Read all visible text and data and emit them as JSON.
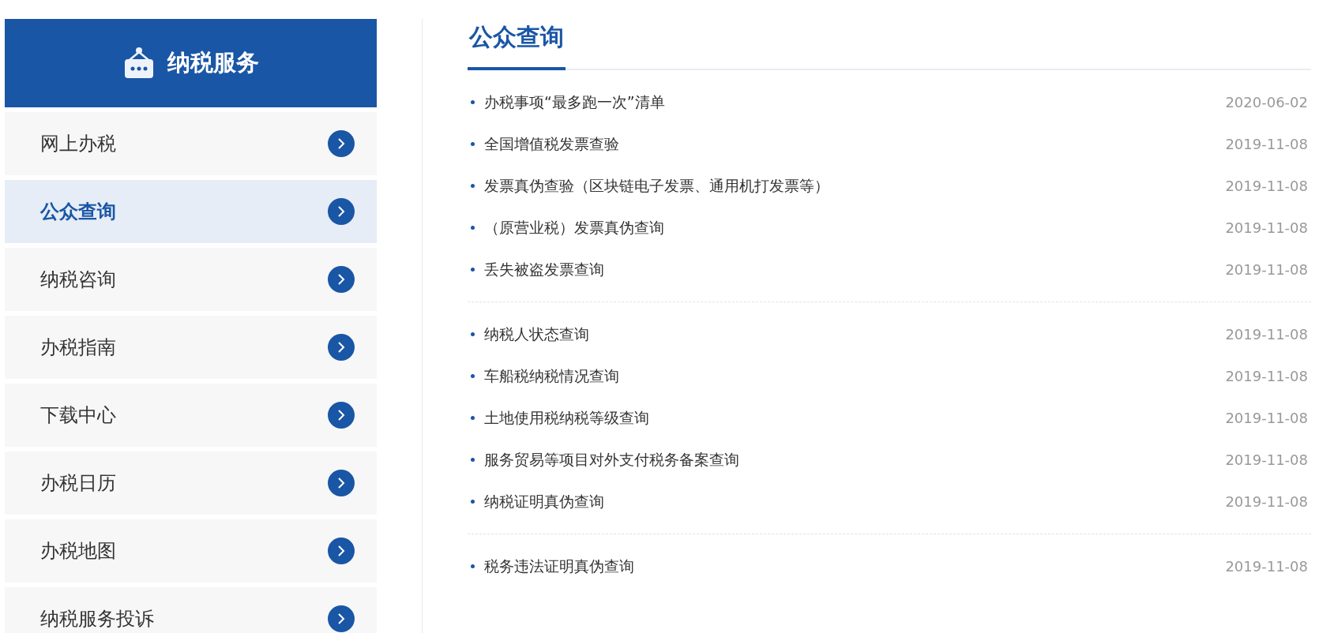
{
  "sidebar": {
    "header": "纳税服务",
    "items": [
      {
        "label": "网上办税",
        "selected": false
      },
      {
        "label": "公众查询",
        "selected": true
      },
      {
        "label": "纳税咨询",
        "selected": false
      },
      {
        "label": "办税指南",
        "selected": false
      },
      {
        "label": "下载中心",
        "selected": false
      },
      {
        "label": "办税日历",
        "selected": false
      },
      {
        "label": "办税地图",
        "selected": false
      },
      {
        "label": "纳税服务投诉",
        "selected": false
      }
    ]
  },
  "content": {
    "title": "公众查询",
    "groups": [
      {
        "items": [
          {
            "title": "办税事项“最多跑一次”清单",
            "date": "2020-06-02"
          },
          {
            "title": "全国增值税发票查验",
            "date": "2019-11-08"
          },
          {
            "title": "发票真伪查验（区块链电子发票、通用机打发票等）",
            "date": "2019-11-08"
          },
          {
            "title": "（原营业税）发票真伪查询",
            "date": "2019-11-08"
          },
          {
            "title": "丢失被盗发票查询",
            "date": "2019-11-08"
          }
        ]
      },
      {
        "items": [
          {
            "title": "纳税人状态查询",
            "date": "2019-11-08"
          },
          {
            "title": "车船税纳税情况查询",
            "date": "2019-11-08"
          },
          {
            "title": "土地使用税纳税等级查询",
            "date": "2019-11-08"
          },
          {
            "title": "服务贸易等项目对外支付税务备案查询",
            "date": "2019-11-08"
          },
          {
            "title": "纳税证明真伪查询",
            "date": "2019-11-08"
          }
        ]
      },
      {
        "items": [
          {
            "title": "税务违法证明真伪查询",
            "date": "2019-11-08"
          }
        ]
      }
    ]
  }
}
